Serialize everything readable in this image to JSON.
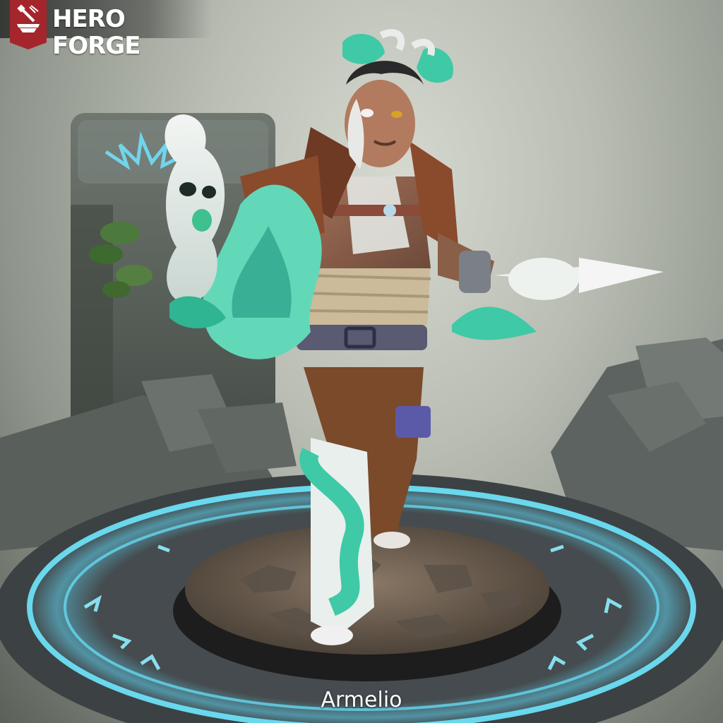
{
  "header": {
    "brand": "HERO FORGE",
    "logo_icon": "anvil-hammer-icon",
    "brand_color": "#a4262c"
  },
  "viewer": {
    "character_name": "Armelio",
    "rune_glow_color": "#5fe0ff",
    "accent_color": "#3fc9a6"
  }
}
